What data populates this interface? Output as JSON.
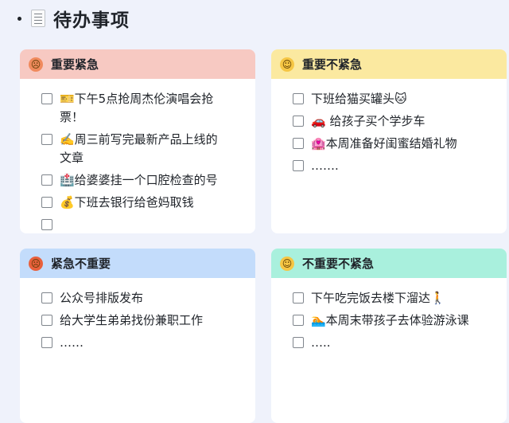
{
  "page": {
    "title": "待办事项",
    "title_icon": "memo-icon"
  },
  "quadrants": [
    {
      "title": "重要紧急",
      "emoji": "hot-face-icon",
      "header_color": "#f7c9c2",
      "emoji_color": "#f08a5d",
      "items": [
        "🎫下午5点抢周杰伦演唱会抢票！",
        "✍️周三前写完最新产品上线的文章",
        "🏥给婆婆挂一个口腔检查的号",
        "💰下班去银行给爸妈取钱",
        ""
      ]
    },
    {
      "title": "重要不紧急",
      "emoji": "relieved-face-icon",
      "header_color": "#fbe9a0",
      "emoji_color": "#f6c644",
      "items": [
        "下班给猫买罐头🐱",
        "🚗 给孩子买个学步车",
        "🏩本周准备好闺蜜结婚礼物",
        "……."
      ]
    },
    {
      "title": "紧急不重要",
      "emoji": "angry-face-icon",
      "header_color": "#c3dcfb",
      "emoji_color": "#e8603c",
      "items": [
        "公众号排版发布",
        "给大学生弟弟找份兼职工作",
        "……"
      ]
    },
    {
      "title": "不重要不紧急",
      "emoji": "smirking-face-icon",
      "header_color": "#a9f0dd",
      "emoji_color": "#f6c644",
      "items": [
        "下午吃完饭去楼下溜达🚶",
        "🏊本周末带孩子去体验游泳课",
        "….."
      ]
    }
  ]
}
